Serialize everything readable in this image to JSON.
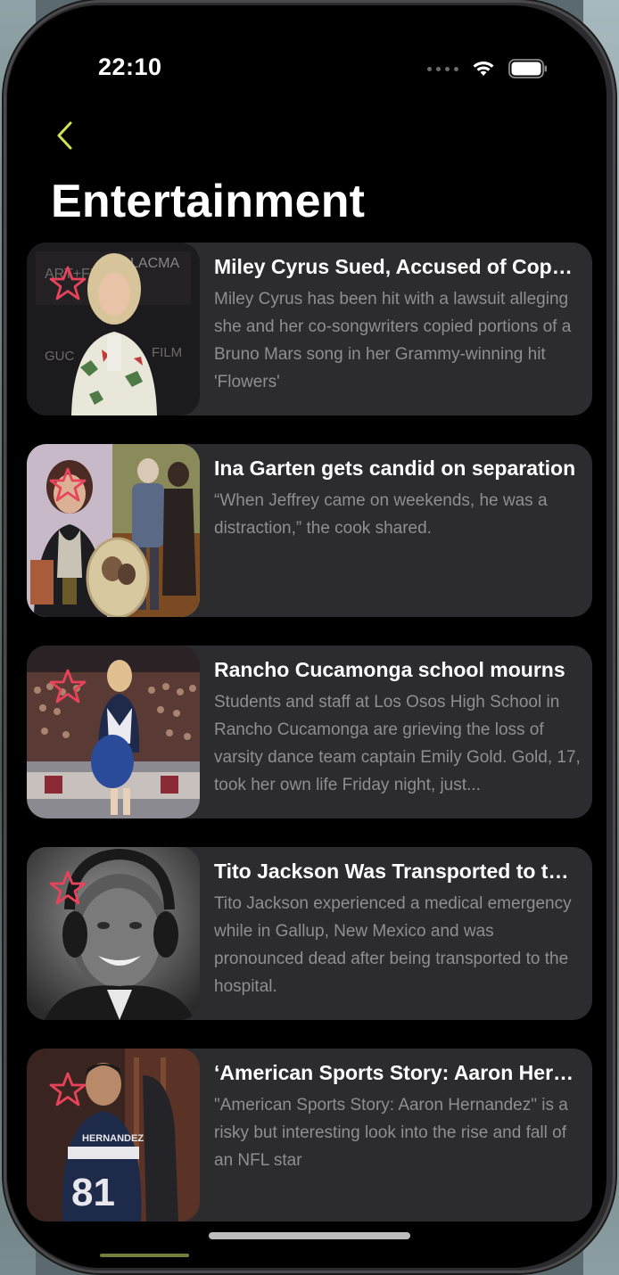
{
  "status_bar": {
    "time": "22:10",
    "icons": [
      "signal-dots-icon",
      "wifi-icon",
      "battery-icon"
    ]
  },
  "nav": {
    "back_icon": "chevron-left-icon",
    "title": "Entertainment"
  },
  "colors": {
    "accent": "#d4e157",
    "star": "#e8435a",
    "card_bg": "#2c2c2e",
    "title_text": "#ffffff",
    "desc_text": "#8e8e93"
  },
  "articles": [
    {
      "title": "Miley Cyrus Sued, Accused of Copying Bruno Mars Song",
      "description": "Miley Cyrus has been hit with a lawsuit alleging she and her co-songwriters copied portions of a Bruno Mars song in her Grammy-winning hit 'Flowers'",
      "favorite_icon": "star-outline-icon"
    },
    {
      "title": "Ina Garten gets candid on separation",
      "description": "“When Jeffrey came on weekends, he was a distraction,” the cook shared.",
      "favorite_icon": "star-outline-icon"
    },
    {
      "title": "Rancho Cucamonga school mourns",
      "description": "Students and staff at Los Osos High School in Rancho Cucamonga are grieving the loss of varsity dance team captain Emily Gold. Gold, 17, took her own life Friday night, just...",
      "favorite_icon": "star-outline-icon"
    },
    {
      "title": "Tito Jackson Was Transported to the Hospital",
      "description": "Tito Jackson experienced a medical emergency while in Gallup, New Mexico and was pronounced dead after being transported to the hospital.",
      "favorite_icon": "star-outline-icon"
    },
    {
      "title": "‘American Sports Story: Aaron Hernandez’",
      "description": "\"American Sports Story: Aaron Hernandez\" is a risky but interesting look into the rise and fall of an NFL star",
      "favorite_icon": "star-outline-icon"
    }
  ]
}
